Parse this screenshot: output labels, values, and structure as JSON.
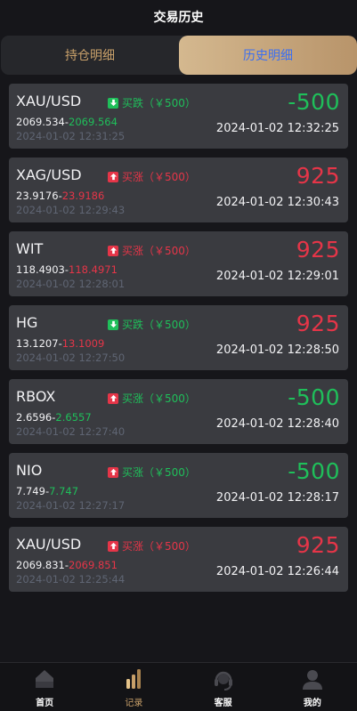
{
  "header": {
    "title": "交易历史"
  },
  "tabs": [
    {
      "label": "持仓明细",
      "active": false
    },
    {
      "label": "历史明细",
      "active": true
    }
  ],
  "colors": {
    "up": "#e53548",
    "down": "#1fbf5a",
    "accent": "#c8a06a",
    "active_tab_text": "#3c6ff0"
  },
  "orders": [
    {
      "symbol": "XAU/USD",
      "dir_icon": "arrow-down-icon",
      "dir_icon_color": "green",
      "direction": "买跌（￥500）",
      "direction_color": "green",
      "open_price": "2069.534",
      "sep": "-",
      "close_price": "2069.564",
      "close_price_color": "green",
      "open_time": "2024-01-02 12:31:25",
      "pnl": "-500",
      "pnl_color": "green",
      "close_time": "2024-01-02 12:32:25"
    },
    {
      "symbol": "XAG/USD",
      "dir_icon": "arrow-up-icon",
      "dir_icon_color": "red",
      "direction": "买涨（￥500）",
      "direction_color": "red",
      "open_price": "23.9176",
      "sep": "-",
      "close_price": "23.9186",
      "close_price_color": "red",
      "open_time": "2024-01-02 12:29:43",
      "pnl": "925",
      "pnl_color": "red",
      "close_time": "2024-01-02 12:30:43"
    },
    {
      "symbol": "WIT",
      "dir_icon": "arrow-up-icon",
      "dir_icon_color": "red",
      "direction": "买涨（￥500）",
      "direction_color": "red",
      "open_price": "118.4903",
      "sep": "-",
      "close_price": "118.4971",
      "close_price_color": "red",
      "open_time": "2024-01-02 12:28:01",
      "pnl": "925",
      "pnl_color": "red",
      "close_time": "2024-01-02 12:29:01"
    },
    {
      "symbol": "HG",
      "dir_icon": "arrow-down-icon",
      "dir_icon_color": "green",
      "direction": "买跌（￥500）",
      "direction_color": "green",
      "open_price": "13.1207",
      "sep": "-",
      "close_price": "13.1009",
      "close_price_color": "red",
      "open_time": "2024-01-02 12:27:50",
      "pnl": "925",
      "pnl_color": "red",
      "close_time": "2024-01-02 12:28:50"
    },
    {
      "symbol": "RBOX",
      "dir_icon": "arrow-up-icon",
      "dir_icon_color": "red",
      "direction": "买涨（￥500）",
      "direction_color": "green",
      "open_price": "2.6596",
      "sep": "-",
      "close_price": "2.6557",
      "close_price_color": "green",
      "open_time": "2024-01-02 12:27:40",
      "pnl": "-500",
      "pnl_color": "green",
      "close_time": "2024-01-02 12:28:40"
    },
    {
      "symbol": "NIO",
      "dir_icon": "arrow-up-icon",
      "dir_icon_color": "red",
      "direction": "买涨（￥500）",
      "direction_color": "green",
      "open_price": "7.749",
      "sep": "-",
      "close_price": "7.747",
      "close_price_color": "green",
      "open_time": "2024-01-02 12:27:17",
      "pnl": "-500",
      "pnl_color": "green",
      "close_time": "2024-01-02 12:28:17"
    },
    {
      "symbol": "XAU/USD",
      "dir_icon": "arrow-up-icon",
      "dir_icon_color": "red",
      "direction": "买涨（￥500）",
      "direction_color": "red",
      "open_price": "2069.831",
      "sep": "-",
      "close_price": "2069.851",
      "close_price_color": "red",
      "open_time": "2024-01-02 12:25:44",
      "pnl": "925",
      "pnl_color": "red",
      "close_time": "2024-01-02 12:26:44"
    }
  ],
  "nav": [
    {
      "label": "首页",
      "icon": "home-icon",
      "active": false
    },
    {
      "label": "记录",
      "icon": "records-icon",
      "active": true
    },
    {
      "label": "客服",
      "icon": "headset-icon",
      "active": false
    },
    {
      "label": "我的",
      "icon": "user-icon",
      "active": false
    }
  ]
}
